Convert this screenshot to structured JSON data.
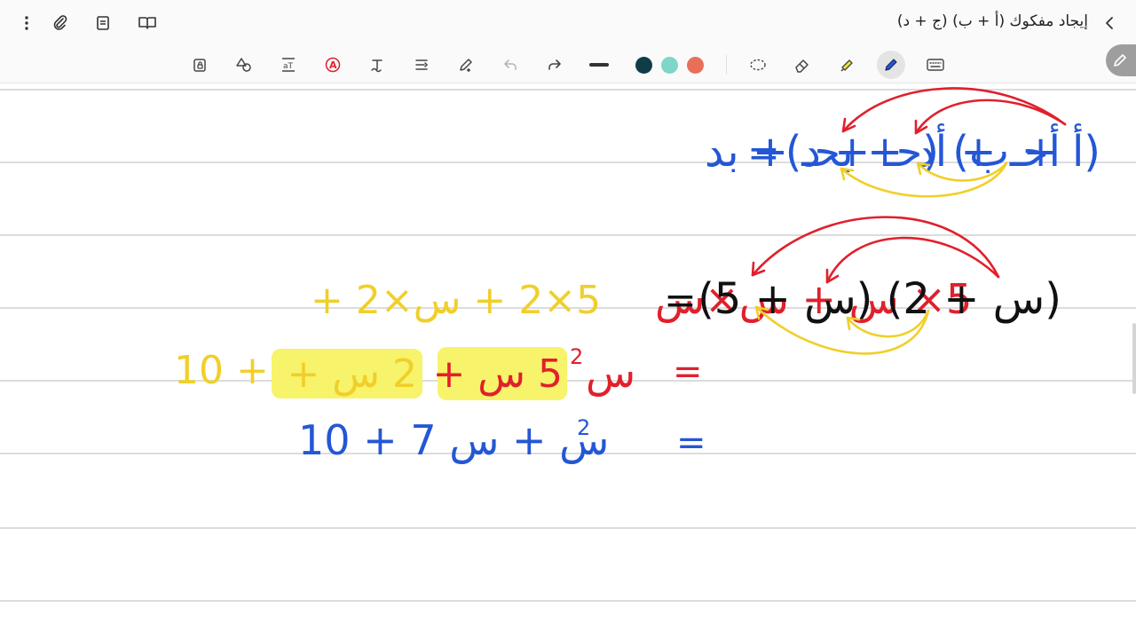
{
  "header": {
    "title": "إيجاد مفكوك (أ + ب) (ج + د)",
    "back_icon": "chevron-left-icon",
    "menu_icon": "more-vertical-icon"
  },
  "toolbar": {
    "tools": [
      "lock-icon",
      "shapes-icon",
      "text-box-icon",
      "text-color-icon",
      "handwriting-text-icon",
      "line-spacing-icon",
      "pen-settings-icon",
      "undo-icon",
      "redo-icon",
      "stroke-width-icon",
      "lasso-icon",
      "eraser-icon",
      "highlighter-icon",
      "pen-icon",
      "keyboard-icon"
    ],
    "colors": [
      "#0f3d47",
      "#7fd6c8",
      "#e8705a"
    ]
  },
  "colors": {
    "blue": "#2457d6",
    "red": "#e0202c",
    "yellow": "#f0cf2a",
    "black": "#111111",
    "highlight": "#f7f36a"
  },
  "notes": {
    "line1_left": "أحـ + أد + بحـ + بد",
    "line1_eq": "=",
    "line1_right": "(أ + ب) (حـ + د)",
    "line2_yellow": "5×2 + س×2 +",
    "line2_red": "5× س + س×س",
    "line2_eq": "=",
    "line2_right": "(س + 2) (س + 5)",
    "line3_ten": "10 +",
    "line3_hl1": "2 س +",
    "line3_hl2": "5 س +",
    "line3_sq": "س",
    "line3_exp": "2",
    "line3_eq": "=",
    "line4_expr": "10 + 7 س + س",
    "line4_exp": "2",
    "line4_eq": "="
  }
}
